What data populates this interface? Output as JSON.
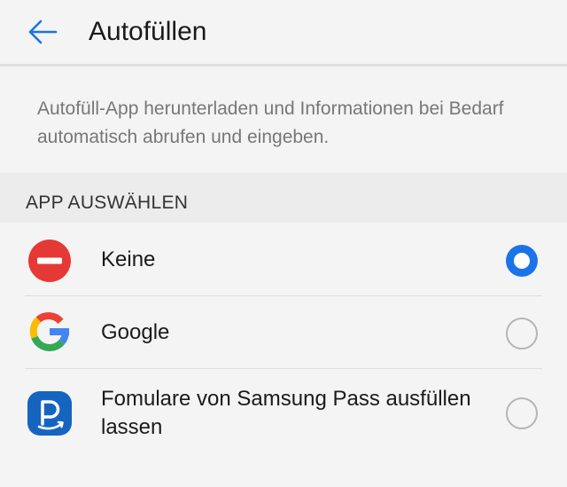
{
  "header": {
    "title": "Autofüllen",
    "back_icon": "arrow-left-icon",
    "accent_color": "#1a73e8"
  },
  "description": {
    "text": "Autofüll-App herunterladen und Informationen bei Bedarf automatisch abrufen und eingeben."
  },
  "section": {
    "title": "APP AUSWÄHLEN"
  },
  "apps": [
    {
      "label": "Keine",
      "icon": "no-entry-icon",
      "selected": true
    },
    {
      "label": "Google",
      "icon": "google-icon",
      "selected": false
    },
    {
      "label": "Fomulare von Samsung Pass ausfüllen lassen",
      "icon": "samsung-pass-icon",
      "selected": false
    }
  ]
}
